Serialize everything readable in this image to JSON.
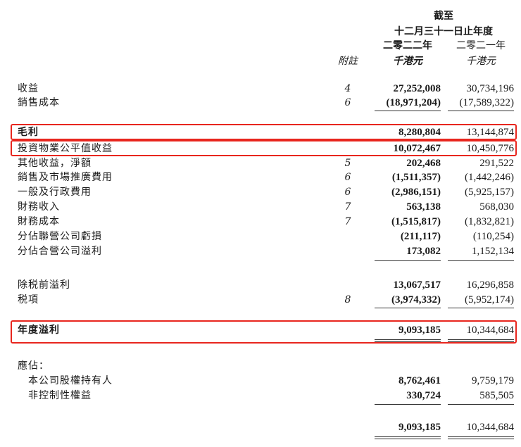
{
  "header": {
    "as_at": "截至",
    "date": "十二月三十一日止年度",
    "year_2022": "二零二二年",
    "year_2021": "二零二一年",
    "note_label": "附註",
    "unit_2022": "千港元",
    "unit_2021": "千港元"
  },
  "rows": [
    {
      "label": "收益",
      "note": "4",
      "y2022": "27,252,008",
      "y2021": "30,734,196"
    },
    {
      "label": "銷售成本",
      "note": "6",
      "y2022": "(18,971,204)",
      "y2021": "(17,589,322)"
    },
    {
      "label": "毛利",
      "note": "",
      "y2022": "8,280,804",
      "y2021": "13,144,874"
    },
    {
      "label": "投資物業公平值收益",
      "note": "",
      "y2022": "10,072,467",
      "y2021": "10,450,776"
    },
    {
      "label": "其他收益，淨額",
      "note": "5",
      "y2022": "202,468",
      "y2021": "291,522"
    },
    {
      "label": "銷售及市場推廣費用",
      "note": "6",
      "y2022": "(1,511,357)",
      "y2021": "(1,442,246)"
    },
    {
      "label": "一般及行政費用",
      "note": "6",
      "y2022": "(2,986,151)",
      "y2021": "(5,925,157)"
    },
    {
      "label": "財務收入",
      "note": "7",
      "y2022": "563,138",
      "y2021": "568,030"
    },
    {
      "label": "財務成本",
      "note": "7",
      "y2022": "(1,515,817)",
      "y2021": "(1,832,821)"
    },
    {
      "label": "分佔聯營公司虧損",
      "note": "",
      "y2022": "(211,117)",
      "y2021": "(110,254)"
    },
    {
      "label": "分佔合營公司溢利",
      "note": "",
      "y2022": "173,082",
      "y2021": "1,152,134"
    },
    {
      "label": "除税前溢利",
      "note": "",
      "y2022": "13,067,517",
      "y2021": "16,296,858"
    },
    {
      "label": "税項",
      "note": "8",
      "y2022": "(3,974,332)",
      "y2021": "(5,952,174)"
    },
    {
      "label": "年度溢利",
      "note": "",
      "y2022": "9,093,185",
      "y2021": "10,344,684"
    },
    {
      "label": "應佔：",
      "note": "",
      "y2022": "",
      "y2021": ""
    },
    {
      "label": "本公司股權持有人",
      "note": "",
      "y2022": "8,762,461",
      "y2021": "9,759,179"
    },
    {
      "label": "非控制性權益",
      "note": "",
      "y2022": "330,724",
      "y2021": "585,505"
    },
    {
      "label": "",
      "note": "",
      "y2022": "9,093,185",
      "y2021": "10,344,684"
    }
  ],
  "highlight_color": "#e8261e"
}
